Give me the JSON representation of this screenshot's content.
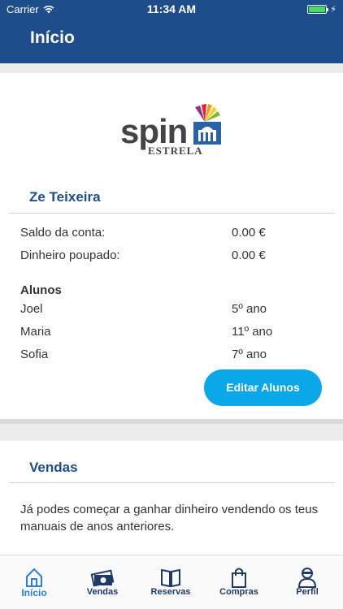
{
  "status_bar": {
    "carrier": "Carrier",
    "time": "11:34 AM"
  },
  "nav": {
    "title": "Início"
  },
  "logo": {
    "name": "spin",
    "subtitle": "ESTRELA"
  },
  "account": {
    "user_name": "Ze Teixeira",
    "balance_label": "Saldo da conta:",
    "balance_value": "0.00 €",
    "saved_label": "Dinheiro poupado:",
    "saved_value": "0.00 €"
  },
  "students": {
    "title": "Alunos",
    "items": [
      {
        "name": "Joel",
        "grade": "5º ano"
      },
      {
        "name": "Maria",
        "grade": "11º ano"
      },
      {
        "name": "Sofia",
        "grade": "7º ano"
      }
    ],
    "edit_label": "Editar Alunos"
  },
  "sales": {
    "title": "Vendas",
    "text": "Já podes começar a ganhar dinheiro vendendo os teus manuais de anos anteriores."
  },
  "tabs": [
    {
      "label": "Início",
      "icon": "home-icon",
      "active": true
    },
    {
      "label": "Vendas",
      "icon": "money-icon",
      "active": false
    },
    {
      "label": "Reservas",
      "icon": "book-icon",
      "active": false
    },
    {
      "label": "Compras",
      "icon": "bag-icon",
      "active": false
    },
    {
      "label": "Perfil",
      "icon": "person-icon",
      "active": false
    }
  ],
  "colors": {
    "header": "#1e4d8c",
    "button": "#0aa8e8",
    "active_tab": "#2a7fd6"
  }
}
